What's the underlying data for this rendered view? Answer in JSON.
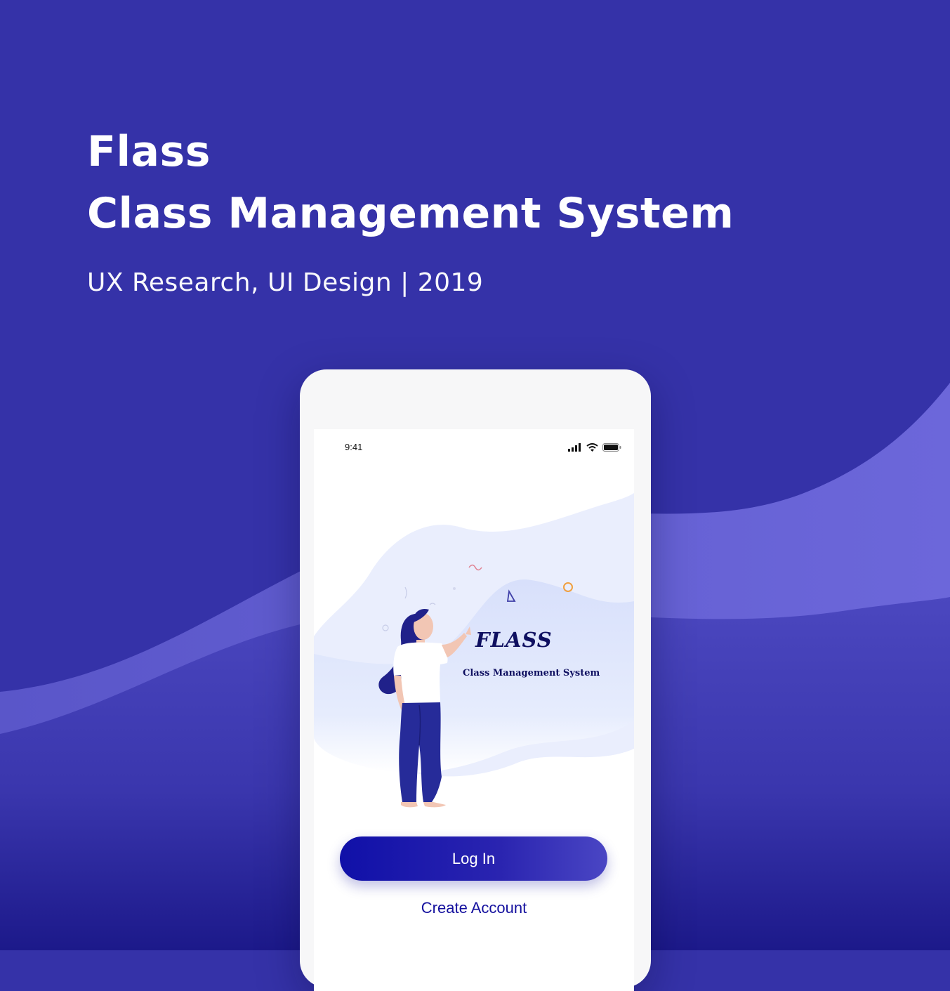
{
  "hero": {
    "title_line1": "Flass",
    "title_line2": "Class Management System",
    "subtitle": "UX Research, UI Design | 2019"
  },
  "colors": {
    "background": "#3532a8",
    "wave_light": "#6b65d8",
    "wave_mid": "#5753c8",
    "brand_navy": "#0e0f60",
    "button_primary": "#1010a8",
    "link": "#14109e"
  },
  "phone": {
    "status_bar": {
      "time": "9:41",
      "icons": [
        "signal-icon",
        "wifi-icon",
        "battery-icon"
      ]
    },
    "splash": {
      "brand": "FLASS",
      "tagline": "Class Management System"
    },
    "actions": {
      "login_label": "Log In",
      "create_account_label": "Create Account"
    }
  }
}
